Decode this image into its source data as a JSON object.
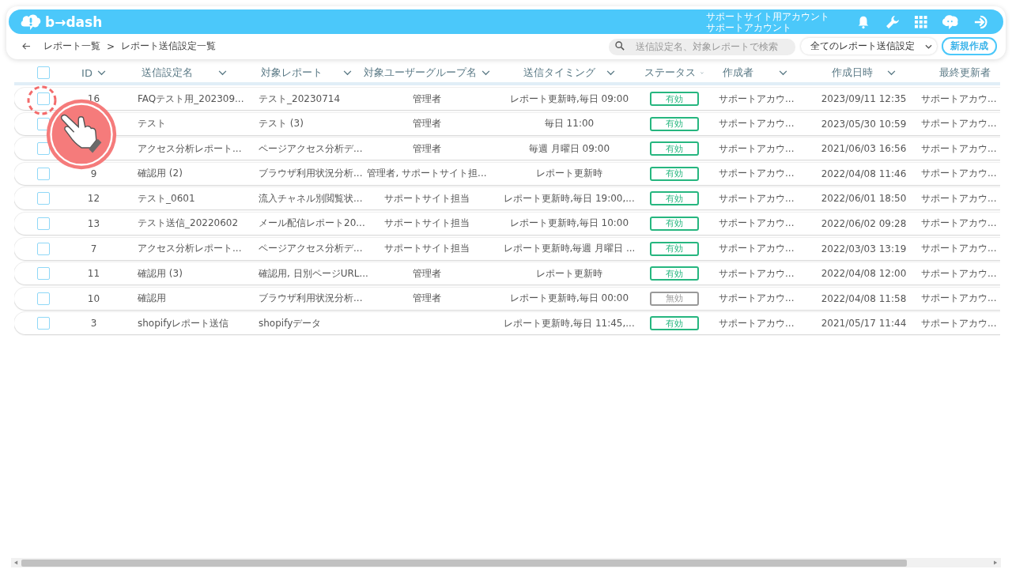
{
  "header": {
    "logo": "b→dash",
    "account_lines": [
      "サポートサイト用アカウント",
      "サポートアカウント"
    ]
  },
  "breadcrumb": {
    "parent": "レポート一覧",
    "separator": ">",
    "current": "レポート送信設定一覧"
  },
  "search": {
    "placeholder": "送信設定名、対象レポートで検索"
  },
  "filter": {
    "value": "全てのレポート送信設定"
  },
  "new_button": "新規作成",
  "select_all_checked": false,
  "columns": [
    {
      "label": "ID"
    },
    {
      "label": "送信設定名"
    },
    {
      "label": "対象レポート"
    },
    {
      "label": "対象ユーザーグループ名"
    },
    {
      "label": "送信タイミング"
    },
    {
      "label": "ステータス"
    },
    {
      "label": "作成者"
    },
    {
      "label": "作成日時"
    },
    {
      "label": "最終更新者"
    }
  ],
  "rows": [
    {
      "checked": false,
      "id": "16",
      "name": "FAQテスト用_202309...",
      "report": "テスト_20230714",
      "group": "管理者",
      "timing": "レポート更新時,毎日 09:00",
      "status": "有効",
      "active": true,
      "author": "サポートアカウ...",
      "date": "2023/09/11 12:35",
      "updater": "サポートアカウ..."
    },
    {
      "checked": false,
      "name": "テスト",
      "report": "テスト (3)",
      "group": "管理者",
      "timing": "毎日 11:00",
      "status": "有効",
      "active": true,
      "author": "サポートアカウ...",
      "date": "2023/05/30 10:59",
      "updater": "サポートアカウ..."
    },
    {
      "checked": false,
      "name": "アクセス分析レポート...",
      "report": "ページアクセス分析デ...",
      "group": "管理者",
      "timing": "毎週 月曜日 09:00",
      "status": "有効",
      "active": true,
      "author": "サポートアカウ...",
      "date": "2021/06/03 16:56",
      "updater": "サポートアカウ..."
    },
    {
      "checked": false,
      "id": "9",
      "name": "確認用 (2)",
      "report": "ブラウザ利用状況分析...",
      "group": "管理者, サポートサイト担...",
      "timing": "レポート更新時",
      "status": "有効",
      "active": true,
      "author": "サポートアカウ...",
      "date": "2022/04/08 11:46",
      "updater": "サポートアカウ..."
    },
    {
      "checked": false,
      "id": "12",
      "name": "テスト_0601",
      "report": "流入チャネル別閲覧状...",
      "group": "サポートサイト担当",
      "timing": "レポート更新時,毎日 19:00,...",
      "status": "有効",
      "active": true,
      "author": "サポートアカウ...",
      "date": "2022/06/01 18:50",
      "updater": "サポートアカウ..."
    },
    {
      "checked": false,
      "id": "13",
      "name": "テスト送信_20220602",
      "report": "メール配信レポート20...",
      "group": "サポートサイト担当",
      "timing": "レポート更新時,毎日 10:00",
      "status": "有効",
      "active": true,
      "author": "サポートアカウ...",
      "date": "2022/06/02 09:28",
      "updater": "サポートアカウ..."
    },
    {
      "checked": false,
      "id": "7",
      "name": "アクセス分析レポート...",
      "report": "ページアクセス分析デ...",
      "group": "サポートサイト担当",
      "timing": "レポート更新時,毎週 月曜日 ...",
      "status": "有効",
      "active": true,
      "author": "サポートアカウ...",
      "date": "2022/03/03 13:19",
      "updater": "サポートアカウ..."
    },
    {
      "checked": false,
      "id": "11",
      "name": "確認用 (3)",
      "report": "確認用, 日別ページURL...",
      "group": "管理者",
      "timing": "レポート更新時",
      "status": "有効",
      "active": true,
      "author": "サポートアカウ...",
      "date": "2022/04/08 12:00",
      "updater": "サポートアカウ..."
    },
    {
      "checked": false,
      "id": "10",
      "name": "確認用",
      "report": "ブラウザ利用状況分析...",
      "group": "管理者",
      "timing": "レポート更新時,毎日 00:00",
      "status": "無効",
      "active": false,
      "author": "サポートアカウ...",
      "date": "2022/04/08 11:58",
      "updater": "サポートアカウ..."
    },
    {
      "checked": false,
      "id": "3",
      "name": "shopifyレポート送信",
      "report": "shopifyデータ",
      "timing": "レポート更新時,毎日 11:45,...",
      "status": "有効",
      "active": true,
      "author": "サポートアカウ...",
      "date": "2021/05/17 11:44",
      "updater": "サポートアカウ..."
    }
  ]
}
